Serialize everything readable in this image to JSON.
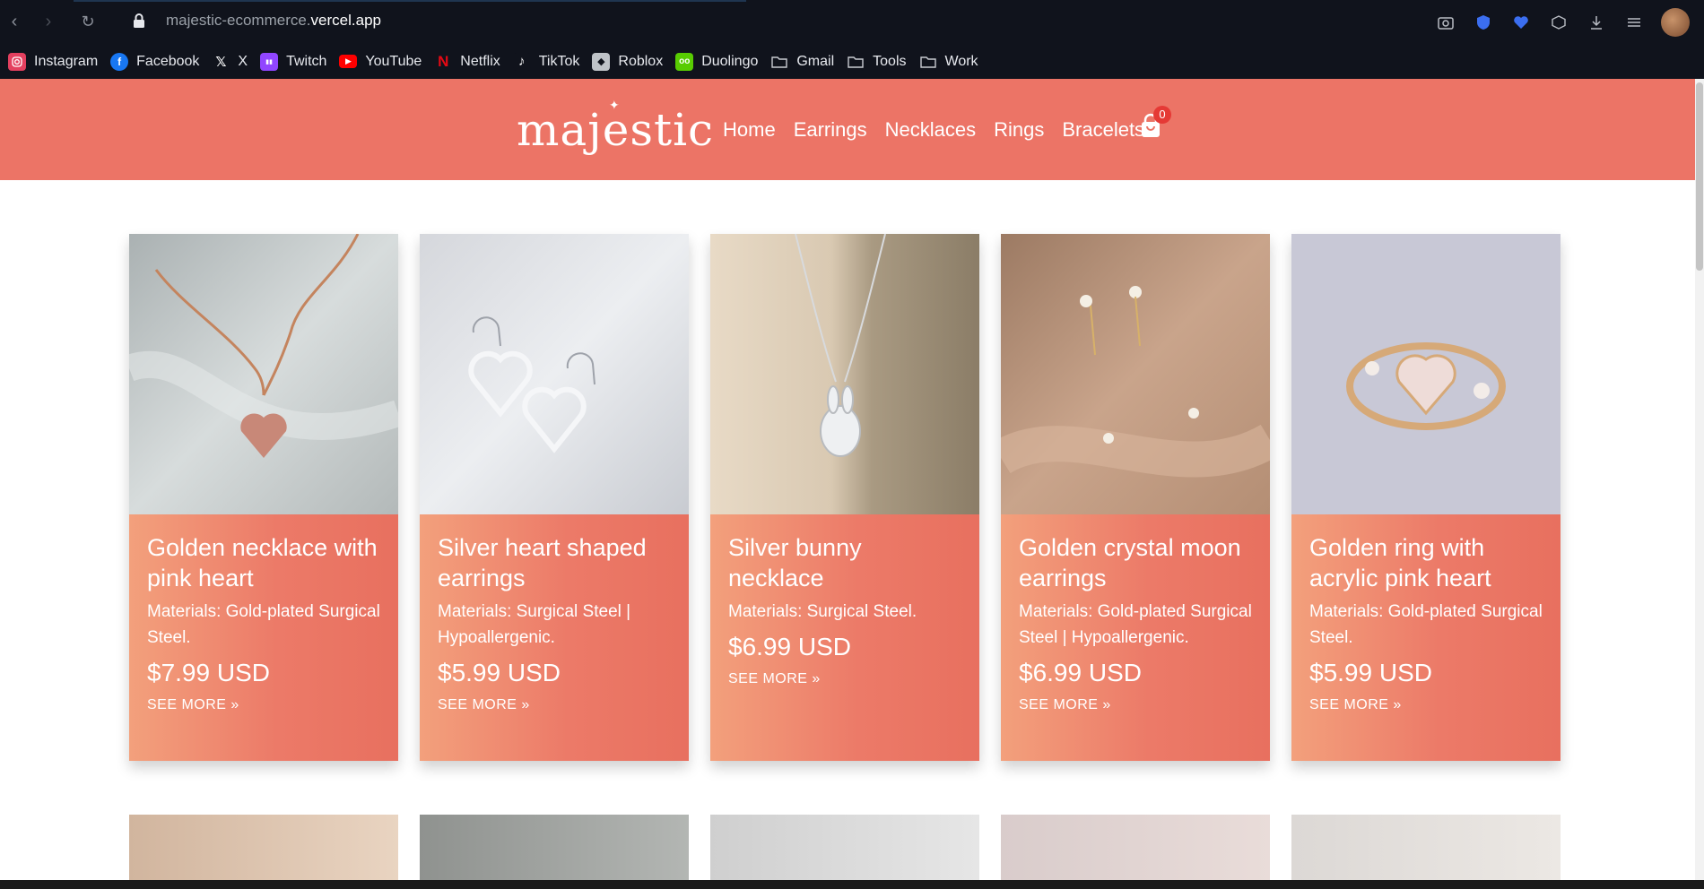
{
  "browser": {
    "url_domain": "majestic-ecommerce.",
    "url_tld": "vercel.app",
    "bookmarks": [
      {
        "label": "Instagram",
        "icon": "instagram-icon",
        "color": "#e4405f"
      },
      {
        "label": "Facebook",
        "icon": "facebook-icon",
        "color": "#1877f2"
      },
      {
        "label": "X",
        "icon": "x-icon",
        "color": "#10131c"
      },
      {
        "label": "Twitch",
        "icon": "twitch-icon",
        "color": "#9146ff"
      },
      {
        "label": "YouTube",
        "icon": "youtube-icon",
        "color": "#ff0000"
      },
      {
        "label": "Netflix",
        "icon": "netflix-icon",
        "color": "#e50914"
      },
      {
        "label": "TikTok",
        "icon": "tiktok-icon",
        "color": "#10131c"
      },
      {
        "label": "Roblox",
        "icon": "roblox-icon",
        "color": "#bfc3c8"
      },
      {
        "label": "Duolingo",
        "icon": "duolingo-icon",
        "color": "#58cc02"
      },
      {
        "label": "Gmail",
        "icon": "folder-icon",
        "color": "#10131c"
      },
      {
        "label": "Tools",
        "icon": "folder-icon",
        "color": "#10131c"
      },
      {
        "label": "Work",
        "icon": "folder-icon",
        "color": "#10131c"
      }
    ]
  },
  "site": {
    "logo": "majestic",
    "nav": [
      "Home",
      "Earrings",
      "Necklaces",
      "Rings",
      "Bracelets"
    ],
    "cart_count": "0",
    "accent": "#ec7466"
  },
  "products": [
    {
      "title": "Golden necklace with pink heart",
      "materials": "Materials: Gold-plated Surgical Steel.",
      "price": "$7.99 USD",
      "more": "SEE MORE »"
    },
    {
      "title": "Silver heart shaped earrings",
      "materials": "Materials: Surgical Steel | Hypoallergenic.",
      "price": "$5.99 USD",
      "more": "SEE MORE »"
    },
    {
      "title": "Silver bunny necklace",
      "materials": "Materials: Surgical Steel.",
      "price": "$6.99 USD",
      "more": "SEE MORE »"
    },
    {
      "title": "Golden crystal moon earrings",
      "materials": "Materials: Gold-plated Surgical Steel | Hypoallergenic.",
      "price": "$6.99 USD",
      "more": "SEE MORE »"
    },
    {
      "title": "Golden ring with acrylic pink heart",
      "materials": "Materials: Gold-plated Surgical Steel.",
      "price": "$5.99 USD",
      "more": "SEE MORE »"
    }
  ]
}
